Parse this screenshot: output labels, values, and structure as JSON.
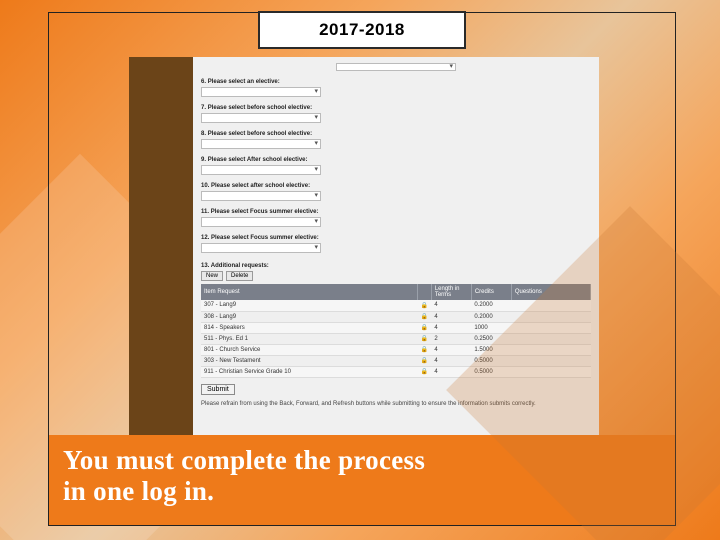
{
  "title": "2017-2018",
  "questions": [
    {
      "num": "6.",
      "label": "Please select an elective:"
    },
    {
      "num": "7.",
      "label": "Please select before school elective:"
    },
    {
      "num": "8.",
      "label": "Please select before school elective:"
    },
    {
      "num": "9.",
      "label": "Please select After school elective:"
    },
    {
      "num": "10.",
      "label": "Please select after school elective:"
    },
    {
      "num": "11.",
      "label": "Please select Focus summer elective:"
    },
    {
      "num": "12.",
      "label": "Please select Focus summer elective:"
    }
  ],
  "additional": {
    "num": "13.",
    "label": "Additional requests:",
    "buttons": {
      "new": "New",
      "delete": "Delete"
    },
    "columns": {
      "item": "Item Request",
      "lock": "",
      "length": "Length in Terms",
      "credits": "Credits",
      "questions": "Questions"
    },
    "rows": [
      {
        "item": "307 - Lang9",
        "length": "4",
        "credits": "0.2000"
      },
      {
        "item": "308 - Lang9",
        "length": "4",
        "credits": "0.2000"
      },
      {
        "item": "814 - Speakers",
        "length": "4",
        "credits": "1000"
      },
      {
        "item": "511 - Phys. Ed 1",
        "length": "2",
        "credits": "0.2500"
      },
      {
        "item": "801 - Church Service",
        "length": "4",
        "credits": "1.5000"
      },
      {
        "item": "303 - New Testament",
        "length": "4",
        "credits": "0.5000"
      },
      {
        "item": "911 - Christian Service Grade 10",
        "length": "4",
        "credits": "0.5000"
      }
    ]
  },
  "submit_label": "Submit",
  "footer_note": "Please refrain from using the Back, Forward, and Refresh buttons while submitting to ensure the information submits correctly.",
  "banner_line1": "You must complete the process",
  "banner_line2": "in one log in."
}
